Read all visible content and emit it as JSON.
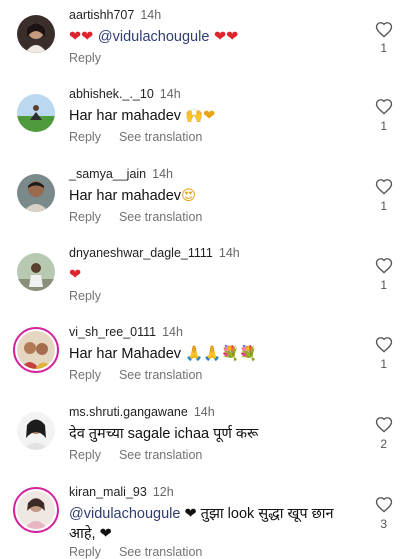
{
  "comments": [
    {
      "username": "aartishh707",
      "time": "14h",
      "text_prefix": "❤❤ ",
      "mention": "@vidulachougule",
      "text_suffix": " ❤❤",
      "actions": [
        "Reply"
      ],
      "likes": "1"
    },
    {
      "username": "abhishek._._10",
      "time": "14h",
      "text_prefix": "Har har mahadev ",
      "emoji": "🙌❤",
      "actions": [
        "Reply",
        "See translation"
      ],
      "likes": "1"
    },
    {
      "username": "_samya__jain",
      "time": "14h",
      "text_prefix": "Har har mahadev",
      "emoji": "😍",
      "actions": [
        "Reply",
        "See translation"
      ],
      "likes": "1"
    },
    {
      "username": "dnyaneshwar_dagle_1111",
      "time": "14h",
      "emoji": "❤",
      "actions": [
        "Reply"
      ],
      "likes": "1"
    },
    {
      "username": "vi_sh_ree_0111",
      "time": "14h",
      "text_prefix": "Har har Mahadev ",
      "emoji": "🙏🙏💐💐",
      "actions": [
        "Reply",
        "See translation"
      ],
      "likes": "1"
    },
    {
      "username": "ms.shruti.gangawane",
      "time": "14h",
      "text_prefix": "देव तुमच्या sagale ichaa पूर्ण करू",
      "actions": [
        "Reply",
        "See translation"
      ],
      "likes": "2"
    },
    {
      "username": "kiran_mali_93",
      "time": "12h",
      "mention": "@vidulachougule",
      "text_suffix": " ❤ तुझा look सुद्धा खूप छान आहे, ❤",
      "actions": [
        "Reply",
        "See translation"
      ],
      "likes": "3"
    }
  ],
  "icons": {
    "like": "heart-outline-icon"
  }
}
